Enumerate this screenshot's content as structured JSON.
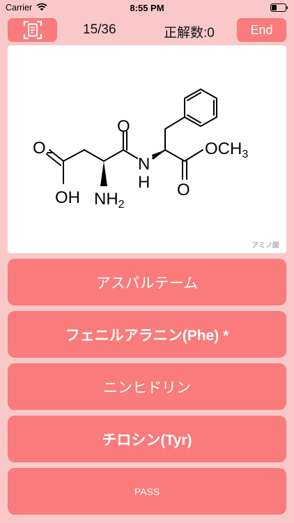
{
  "status_bar": {
    "carrier": "Carrier",
    "time": "8:55 PM"
  },
  "header": {
    "progress": "15/36",
    "score": "正解数:0",
    "end_label": "End"
  },
  "question": {
    "structure_labels": {
      "o_carboxyl": "O",
      "oh": "OH",
      "nh2_n": "NH",
      "nh2_sub": "2",
      "o_amide": "O",
      "nh_n": "N",
      "nh_h": "H",
      "o_ester": "O",
      "och3": "OCH",
      "och3_sub": "3"
    },
    "category": "アミノ酸"
  },
  "answers": [
    {
      "label": "アスパルテーム"
    },
    {
      "label": "フェニルアラニン(Phe) *"
    },
    {
      "label": "ニンヒドリン"
    },
    {
      "label": "チロシン(Tyr)"
    },
    {
      "label": "PASS"
    }
  ],
  "colors": {
    "background": "#f9c9c9",
    "button": "#f97b7b",
    "card": "#ffffff"
  }
}
